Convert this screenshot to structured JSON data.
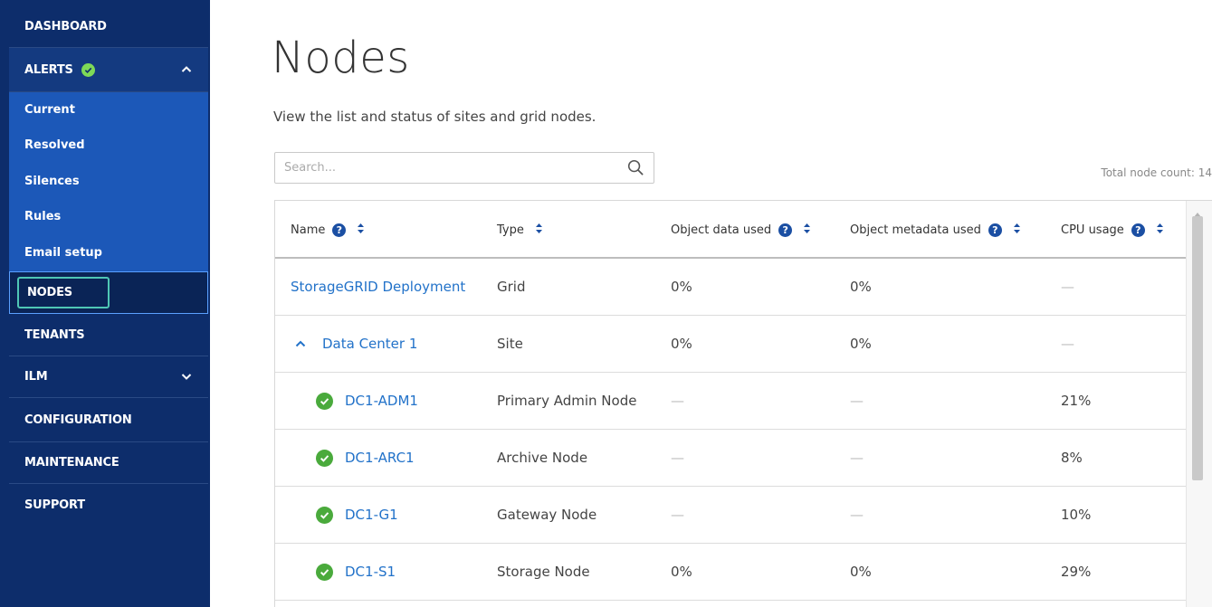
{
  "sidebar": {
    "dashboard": "DASHBOARD",
    "alerts": "ALERTS",
    "alerts_sub": [
      "Current",
      "Resolved",
      "Silences",
      "Rules",
      "Email setup"
    ],
    "nodes": "NODES",
    "tenants": "TENANTS",
    "ilm": "ILM",
    "configuration": "CONFIGURATION",
    "maintenance": "MAINTENANCE",
    "support": "SUPPORT"
  },
  "page": {
    "title": "Nodes",
    "description": "View the list and status of sites and grid nodes.",
    "search_placeholder": "Search...",
    "total_count": "Total node count: 14"
  },
  "table": {
    "headers": [
      "Name",
      "Type",
      "Object data used",
      "Object metadata used",
      "CPU usage"
    ],
    "rows": [
      {
        "name": "StorageGRID Deployment",
        "type": "Grid",
        "data": "0%",
        "meta": "0%",
        "cpu": "—"
      },
      {
        "name": "Data Center 1",
        "type": "Site",
        "data": "0%",
        "meta": "0%",
        "cpu": "—"
      },
      {
        "name": "DC1-ADM1",
        "type": "Primary Admin Node",
        "data": "—",
        "meta": "—",
        "cpu": "21%"
      },
      {
        "name": "DC1-ARC1",
        "type": "Archive Node",
        "data": "—",
        "meta": "—",
        "cpu": "8%"
      },
      {
        "name": "DC1-G1",
        "type": "Gateway Node",
        "data": "—",
        "meta": "—",
        "cpu": "10%"
      },
      {
        "name": "DC1-S1",
        "type": "Storage Node",
        "data": "0%",
        "meta": "0%",
        "cpu": "29%"
      }
    ]
  },
  "icons": {
    "help_glyph": "?"
  },
  "colors": {
    "sidebar": "#0d2d6b",
    "submenu": "#1c58b8",
    "link": "#2272c9",
    "ok": "#4aaa3c"
  }
}
